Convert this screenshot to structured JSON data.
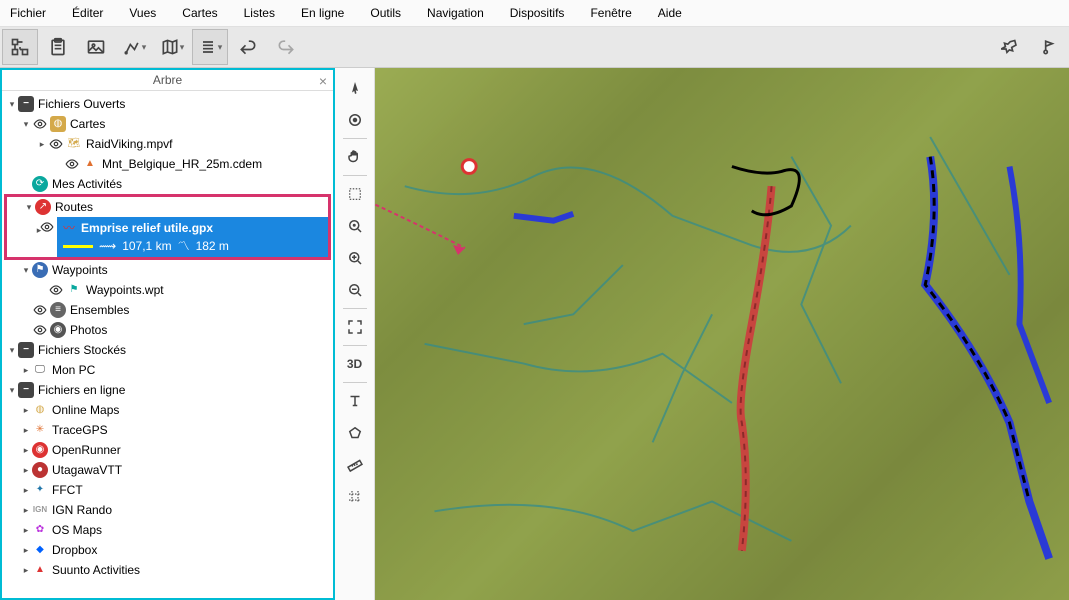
{
  "menu": [
    "Fichier",
    "Éditer",
    "Vues",
    "Cartes",
    "Listes",
    "En ligne",
    "Outils",
    "Navigation",
    "Dispositifs",
    "Fenêtre",
    "Aide"
  ],
  "tree": {
    "title": "Arbre",
    "sections": {
      "open_files": "Fichiers Ouverts",
      "cartes": "Cartes",
      "raidviking": "RaidViking.mpvf",
      "mnt": "Mnt_Belgique_HR_25m.cdem",
      "activities": "Mes Activités",
      "routes": "Routes",
      "selected_name": "Emprise relief utile.gpx",
      "selected_dist": "107,1 km",
      "selected_elev": "182 m",
      "waypoints": "Waypoints",
      "wpt_file": "Waypoints.wpt",
      "ensembles": "Ensembles",
      "photos": "Photos",
      "stored": "Fichiers Stockés",
      "monpc": "Mon PC",
      "online_files": "Fichiers en ligne",
      "online_maps": "Online Maps",
      "tracegps": "TraceGPS",
      "openrunner": "OpenRunner",
      "utagawa": "UtagawaVTT",
      "ffct": "FFCT",
      "ign": "IGN Rando",
      "osmaps": "OS Maps",
      "dropbox": "Dropbox",
      "suunto": "Suunto Activities"
    }
  },
  "maptools_3d": "3D"
}
